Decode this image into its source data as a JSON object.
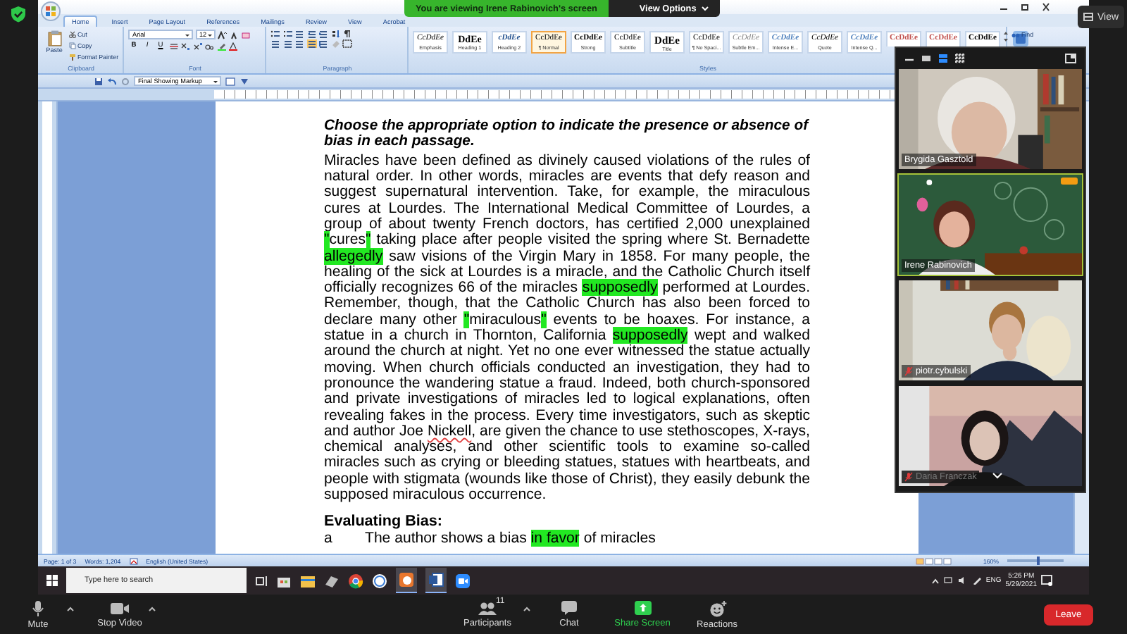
{
  "zoom": {
    "share_banner": "You are viewing Irene Rabinovich's screen",
    "view_options": "View Options",
    "view_button": "View"
  },
  "word": {
    "tabs": [
      {
        "label": "Home",
        "selected": true
      },
      {
        "label": "Insert",
        "selected": false
      },
      {
        "label": "Page Layout",
        "selected": false
      },
      {
        "label": "References",
        "selected": false
      },
      {
        "label": "Mailings",
        "selected": false
      },
      {
        "label": "Review",
        "selected": false
      },
      {
        "label": "View",
        "selected": false
      },
      {
        "label": "Acrobat",
        "selected": false
      }
    ],
    "clipboard": {
      "label": "Clipboard",
      "paste": "Paste",
      "cut": "Cut",
      "copy": "Copy",
      "format_painter": "Format Painter"
    },
    "font": {
      "label": "Font",
      "name": "Arial",
      "size": "12",
      "format_buttons": [
        "B",
        "I",
        "U"
      ]
    },
    "paragraph": {
      "label": "Paragraph"
    },
    "styles": {
      "label": "Styles",
      "items": [
        {
          "preview": "CcDdEe",
          "name": "Emphasis",
          "kind": "italic",
          "selected": false
        },
        {
          "preview": "DdEe",
          "name": "Heading 1",
          "kind": "heading",
          "selected": false
        },
        {
          "preview": "cDdEe",
          "name": "Heading 2",
          "kind": "heading2",
          "selected": false
        },
        {
          "preview": "CcDdEe",
          "name": "¶ Normal",
          "kind": "plain",
          "selected": true
        },
        {
          "preview": "CcDdEe",
          "name": "Strong",
          "kind": "bold",
          "selected": false
        },
        {
          "preview": "CcDdEe",
          "name": "Subtitle",
          "kind": "plain",
          "selected": false
        },
        {
          "preview": "DdEe",
          "name": "Title",
          "kind": "title",
          "selected": false
        },
        {
          "preview": "CcDdEe",
          "name": "¶ No Spaci...",
          "kind": "plain",
          "selected": false
        },
        {
          "preview": "CcDdEe",
          "name": "Subtle Em...",
          "kind": "subtle",
          "selected": false
        },
        {
          "preview": "CcDdEe",
          "name": "Intense E...",
          "kind": "intense",
          "selected": false
        },
        {
          "preview": "CcDdEe",
          "name": "Quote",
          "kind": "italic",
          "selected": false
        },
        {
          "preview": "CcDdEe",
          "name": "Intense Q...",
          "kind": "intense",
          "selected": false
        },
        {
          "preview": "CcDdEe",
          "kind": "red",
          "selected": false
        },
        {
          "preview": "CcDdEe",
          "kind": "red",
          "selected": false
        },
        {
          "preview": "CcDdEe",
          "kind": "bold",
          "selected": false
        }
      ]
    },
    "editing": {
      "find": "Find"
    },
    "quick_access": {
      "markup": "Final Showing Markup"
    },
    "document": {
      "instruction": "Choose the appropriate option to indicate the presence or absence of bias in each passage.",
      "passage": [
        {
          "text": "Miracles have been defined as divinely caused violations of the rules of natural order. In other words, miracles are events that defy reason and suggest supernatural intervention. Take, for example, the miraculous cures at Lourdes. The International Medical Committee of Lourdes, a group of about twenty French doctors, has certified 2,000 unexplained ",
          "kind": "plain"
        },
        {
          "text": "\"",
          "kind": "highlight"
        },
        {
          "text": "cures",
          "kind": "plain"
        },
        {
          "text": "\"",
          "kind": "highlight"
        },
        {
          "text": " taking place after people visited the spring where St. Bernadette ",
          "kind": "plain"
        },
        {
          "text": "allegedly",
          "kind": "highlight"
        },
        {
          "text": " saw visions of the Virgin Mary in 1858. For many people, the healing of the sick at Lourdes is a miracle, and the Catholic Church itself officially recognizes 66 of the miracles ",
          "kind": "plain"
        },
        {
          "text": "supposedly",
          "kind": "highlight"
        },
        {
          "text": " performed at Lourdes. Remember, though, that the Catholic Church has also been forced to declare many other ",
          "kind": "plain"
        },
        {
          "text": "\"",
          "kind": "highlight"
        },
        {
          "text": "miraculous",
          "kind": "plain"
        },
        {
          "text": "\"",
          "kind": "highlight"
        },
        {
          "text": " events to be hoaxes. For instance, a statue in a church in Thornton, California ",
          "kind": "plain"
        },
        {
          "text": "supposedly",
          "kind": "highlight"
        },
        {
          "text": " wept and walked around the church at night. Yet no one ever witnessed the statue actually moving. When church officials conducted an investigation, they had to pronounce the wandering statue a fraud. Indeed, both church-sponsored and private investigations of miracles led to logical explanations, often revealing fakes in the process. Every time investigators, such as skeptic and author Joe ",
          "kind": "plain"
        },
        {
          "text": "Nickell",
          "kind": "spelling"
        },
        {
          "text": ", are given the chance to use stethoscopes, X-rays, chemical analyses, and other scientific tools to examine so-called miracles such as crying or bleeding statues, statues with heartbeats, and people with stigmata (wounds like those of Christ), they easily debunk the supposed miraculous occurrence.",
          "kind": "plain"
        }
      ],
      "section_heading": "Evaluating Bias:",
      "options": [
        {
          "marker": "a",
          "segments": [
            {
              "text": "The author shows a bias ",
              "kind": "plain"
            },
            {
              "text": "in favor",
              "kind": "highlight"
            },
            {
              "text": " of miracles",
              "kind": "plain"
            }
          ]
        }
      ]
    },
    "status_bar": {
      "page": "Page: 1 of 3",
      "words": "Words: 1,204",
      "language": "English (United States)",
      "zoom": "160%",
      "zoom_slider": {
        "level": 0.55
      }
    }
  },
  "gallery": {
    "tiles": [
      {
        "name": "Brygida Gasztold",
        "active_speaker": false,
        "muted": false,
        "badge": false
      },
      {
        "name": "Irene Rabinovich",
        "active_speaker": true,
        "muted": false,
        "badge": true
      },
      {
        "name": "piotr.cybulski",
        "active_speaker": false,
        "muted": true,
        "badge": false
      },
      {
        "name": "Daria Franczak",
        "active_speaker": false,
        "muted": true,
        "badge": false
      }
    ],
    "more_below": true
  },
  "taskbar": {
    "search_placeholder": "Type here to search",
    "language": "ENG",
    "time": "5:26 PM",
    "date": "5/29/2021"
  },
  "toolbar": {
    "items": [
      {
        "label": "Mute",
        "kind": "mic"
      },
      {
        "label": "Stop Video",
        "kind": "video"
      },
      {
        "label": "Participants",
        "kind": "participants",
        "count": "11"
      },
      {
        "label": "Chat",
        "kind": "chat"
      },
      {
        "label": "Share Screen",
        "kind": "share"
      },
      {
        "label": "Reactions",
        "kind": "reactions"
      }
    ],
    "leave": "Leave"
  }
}
